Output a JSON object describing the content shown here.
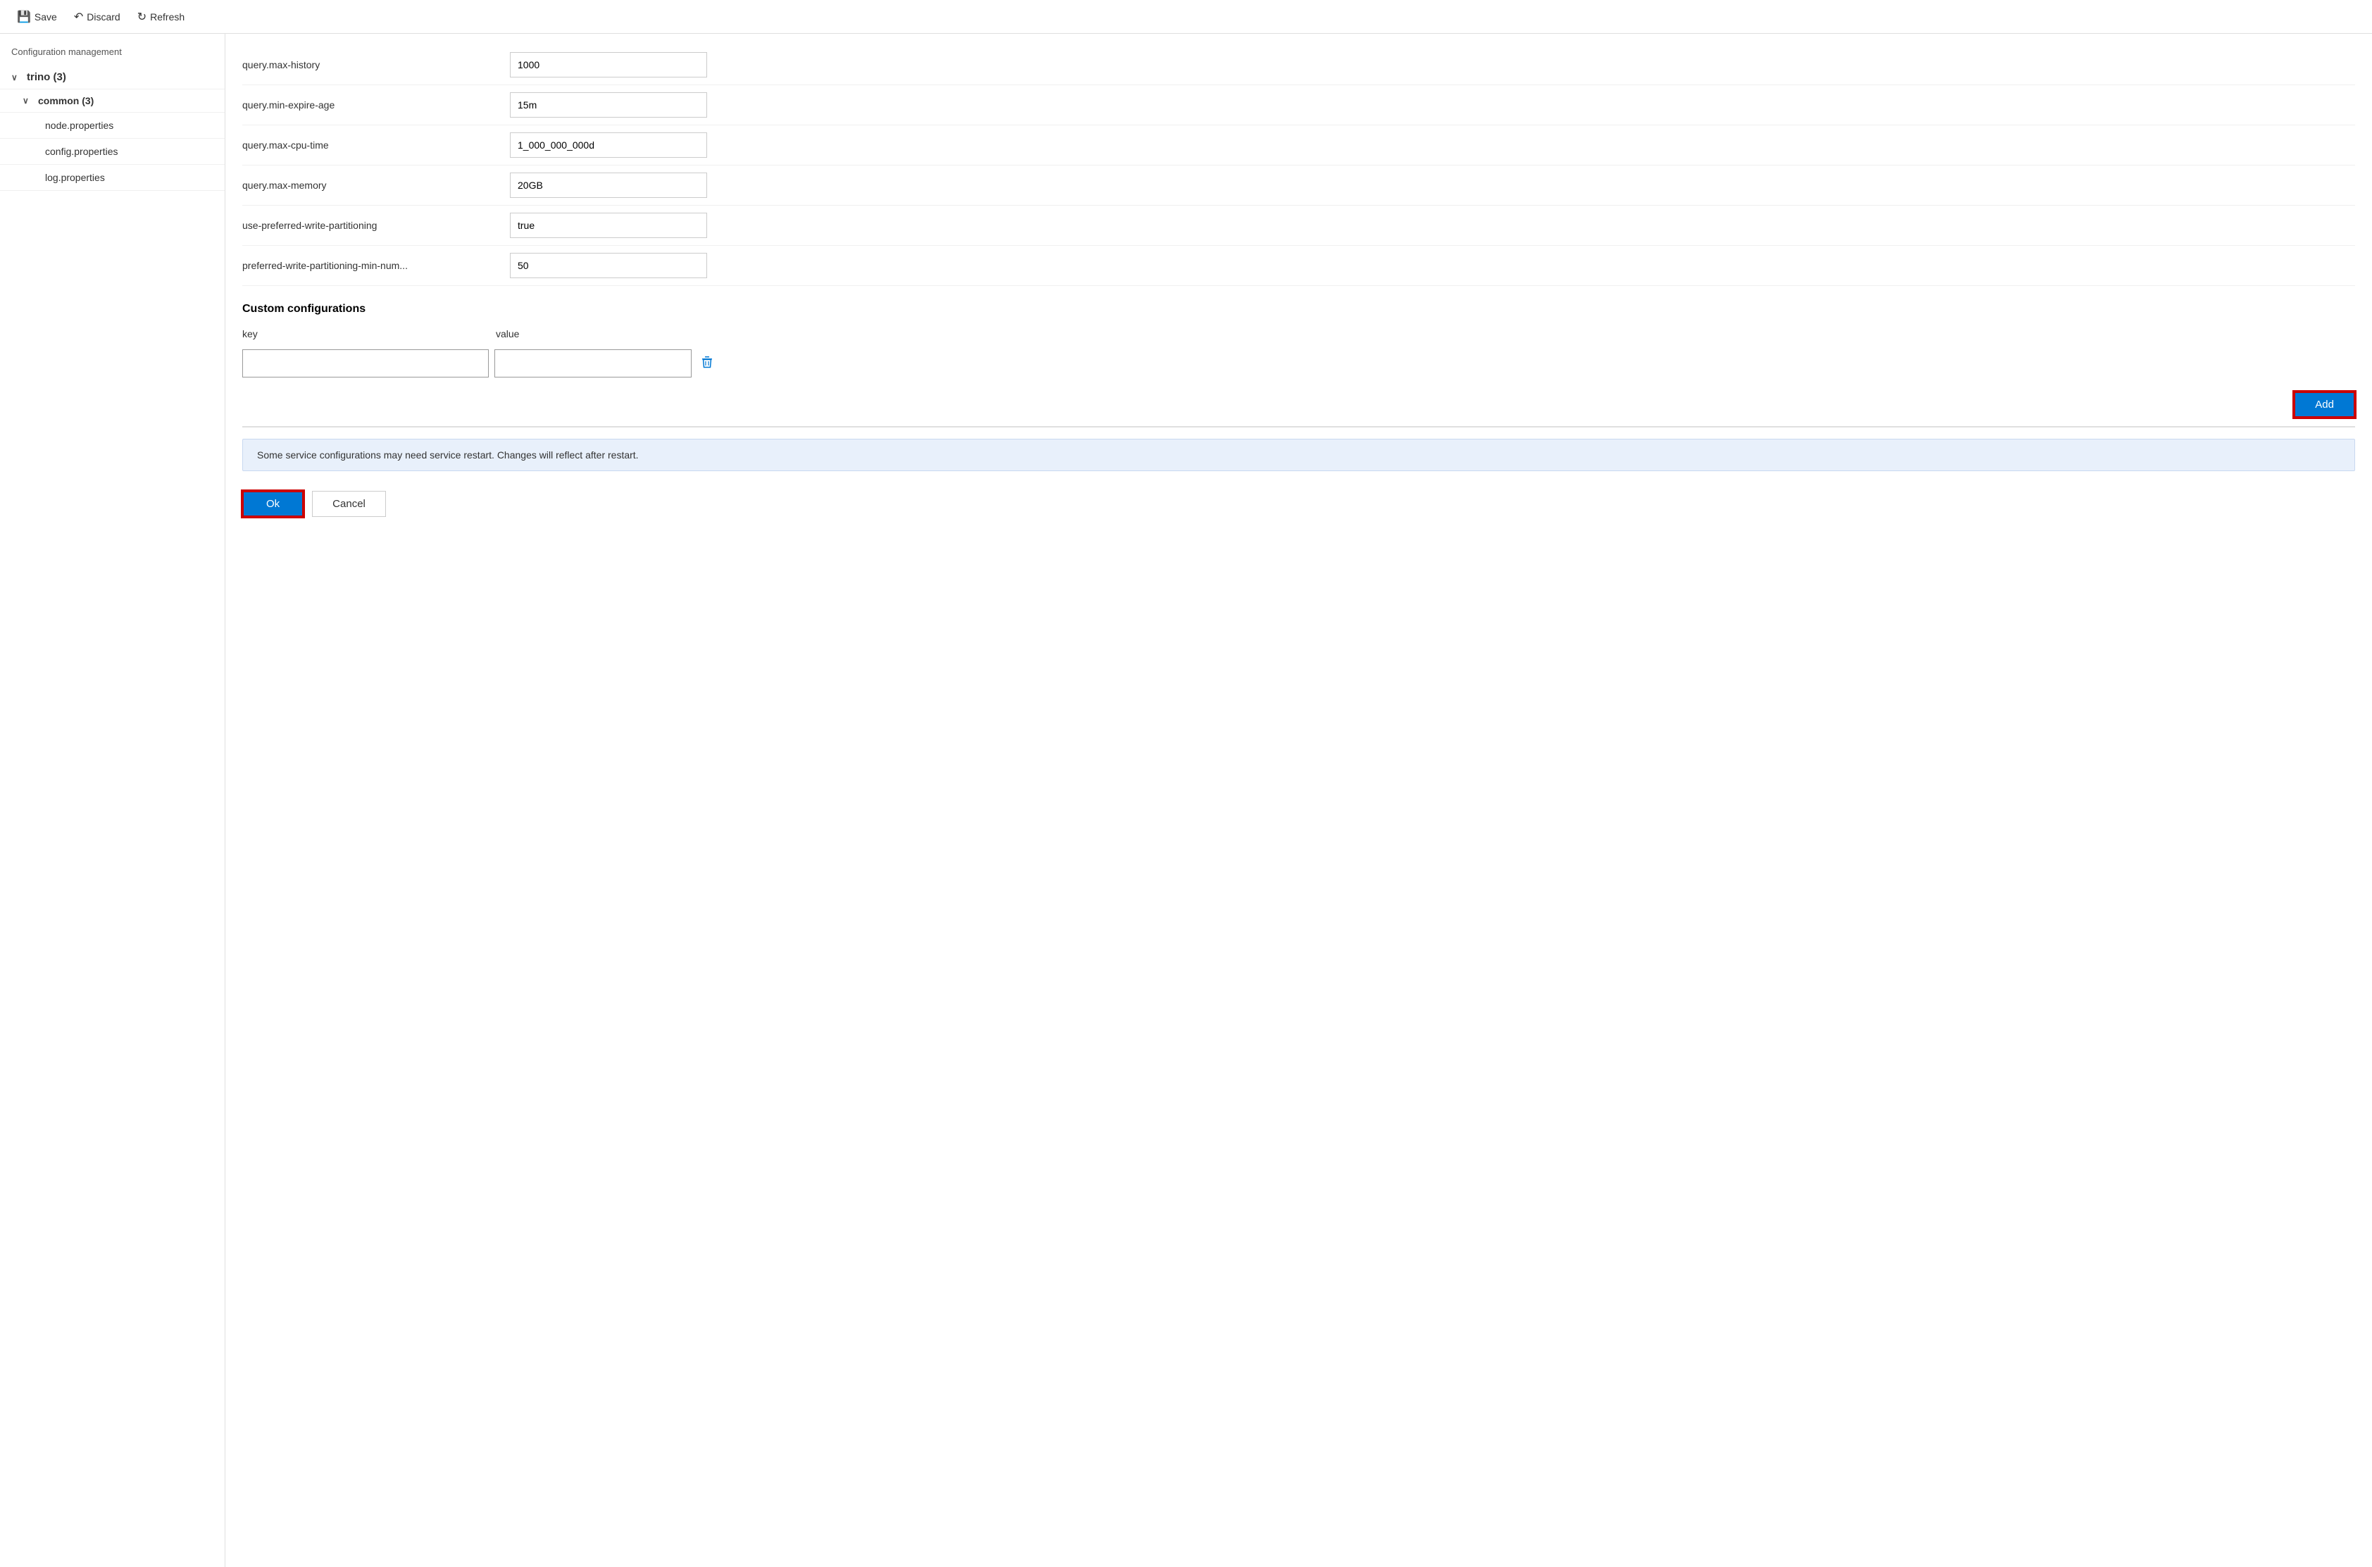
{
  "toolbar": {
    "save_label": "Save",
    "discard_label": "Discard",
    "refresh_label": "Refresh"
  },
  "left_panel": {
    "title": "Configuration management",
    "tree": {
      "root_label": "trino (3)",
      "root_chevron": "∨",
      "sub_label": "common (3)",
      "sub_chevron": "∨",
      "leaves": [
        {
          "label": "node.properties"
        },
        {
          "label": "config.properties"
        },
        {
          "label": "log.properties"
        }
      ]
    }
  },
  "right_panel": {
    "config_rows": [
      {
        "key": "query.max-history",
        "value": "1000"
      },
      {
        "key": "query.min-expire-age",
        "value": "15m"
      },
      {
        "key": "query.max-cpu-time",
        "value": "1_000_000_000d"
      },
      {
        "key": "query.max-memory",
        "value": "20GB"
      },
      {
        "key": "use-preferred-write-partitioning",
        "value": "true"
      },
      {
        "key": "preferred-write-partitioning-min-num...",
        "value": "50"
      }
    ],
    "custom_section": {
      "title": "Custom configurations",
      "col_key": "key",
      "col_value": "value",
      "key_placeholder": "",
      "value_placeholder": "",
      "add_label": "Add"
    },
    "info_banner": "Some service configurations may need service restart. Changes will reflect after restart.",
    "ok_label": "Ok",
    "cancel_label": "Cancel"
  }
}
